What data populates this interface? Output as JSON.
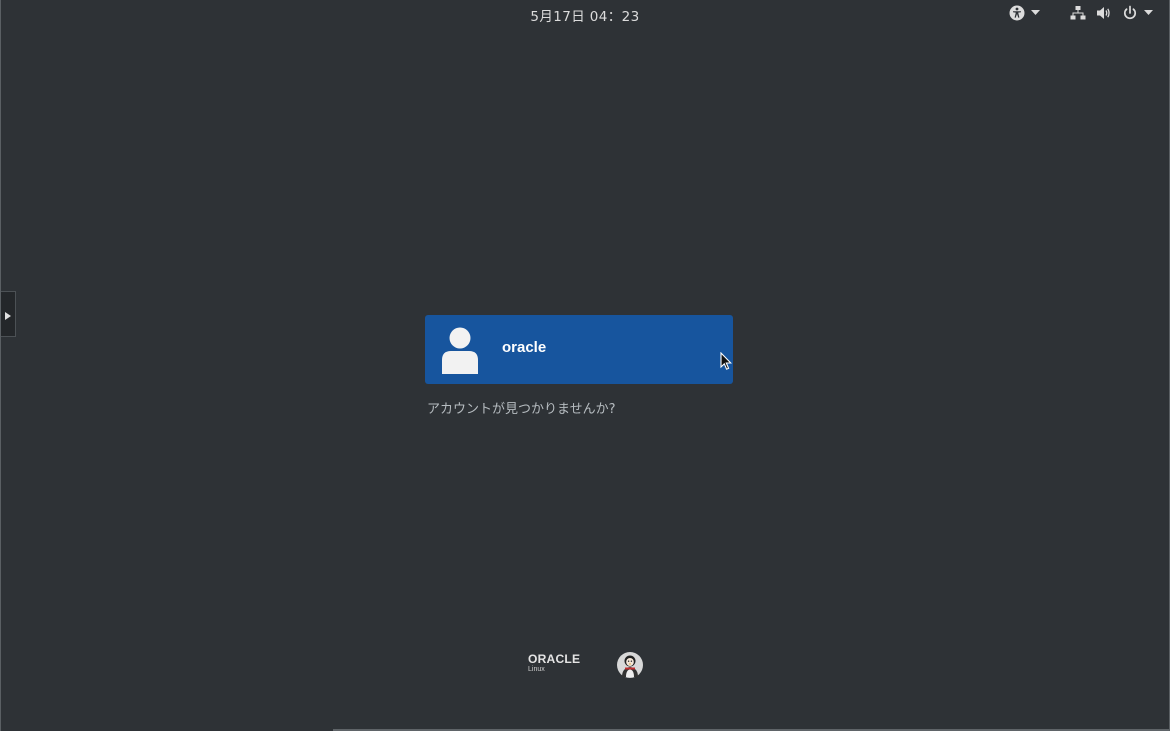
{
  "topbar": {
    "datetime": "5月17日 04：23",
    "icons": [
      "accessibility-icon",
      "network-icon",
      "volume-icon",
      "power-icon"
    ]
  },
  "login": {
    "user": {
      "name": "oracle"
    },
    "not_listed_label": "アカウントが見つかりませんか?"
  },
  "branding": {
    "logo_text": "ORACLE",
    "logo_subtext": "Linux"
  },
  "colors": {
    "background": "#2e3236",
    "selected_user": "#17559e",
    "text": "#dcdcdc"
  }
}
